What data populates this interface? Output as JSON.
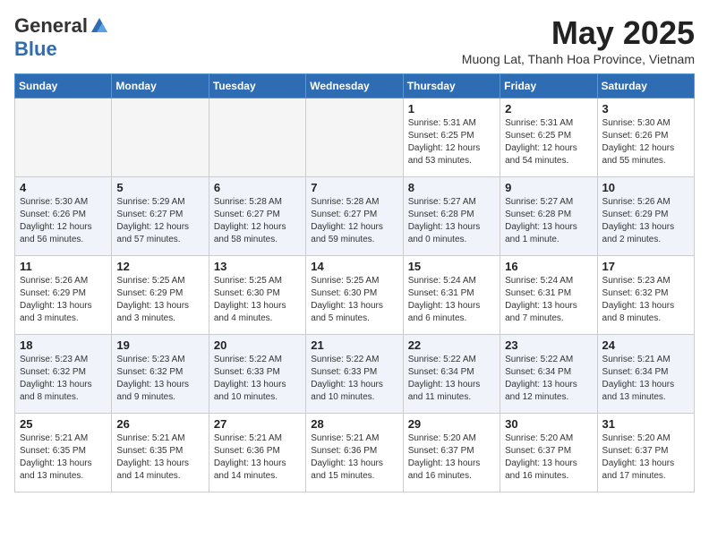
{
  "header": {
    "logo_general": "General",
    "logo_blue": "Blue",
    "month_title": "May 2025",
    "location": "Muong Lat, Thanh Hoa Province, Vietnam"
  },
  "weekdays": [
    "Sunday",
    "Monday",
    "Tuesday",
    "Wednesday",
    "Thursday",
    "Friday",
    "Saturday"
  ],
  "weeks": [
    [
      {
        "day": "",
        "info": ""
      },
      {
        "day": "",
        "info": ""
      },
      {
        "day": "",
        "info": ""
      },
      {
        "day": "",
        "info": ""
      },
      {
        "day": "1",
        "info": "Sunrise: 5:31 AM\nSunset: 6:25 PM\nDaylight: 12 hours\nand 53 minutes."
      },
      {
        "day": "2",
        "info": "Sunrise: 5:31 AM\nSunset: 6:25 PM\nDaylight: 12 hours\nand 54 minutes."
      },
      {
        "day": "3",
        "info": "Sunrise: 5:30 AM\nSunset: 6:26 PM\nDaylight: 12 hours\nand 55 minutes."
      }
    ],
    [
      {
        "day": "4",
        "info": "Sunrise: 5:30 AM\nSunset: 6:26 PM\nDaylight: 12 hours\nand 56 minutes."
      },
      {
        "day": "5",
        "info": "Sunrise: 5:29 AM\nSunset: 6:27 PM\nDaylight: 12 hours\nand 57 minutes."
      },
      {
        "day": "6",
        "info": "Sunrise: 5:28 AM\nSunset: 6:27 PM\nDaylight: 12 hours\nand 58 minutes."
      },
      {
        "day": "7",
        "info": "Sunrise: 5:28 AM\nSunset: 6:27 PM\nDaylight: 12 hours\nand 59 minutes."
      },
      {
        "day": "8",
        "info": "Sunrise: 5:27 AM\nSunset: 6:28 PM\nDaylight: 13 hours\nand 0 minutes."
      },
      {
        "day": "9",
        "info": "Sunrise: 5:27 AM\nSunset: 6:28 PM\nDaylight: 13 hours\nand 1 minute."
      },
      {
        "day": "10",
        "info": "Sunrise: 5:26 AM\nSunset: 6:29 PM\nDaylight: 13 hours\nand 2 minutes."
      }
    ],
    [
      {
        "day": "11",
        "info": "Sunrise: 5:26 AM\nSunset: 6:29 PM\nDaylight: 13 hours\nand 3 minutes."
      },
      {
        "day": "12",
        "info": "Sunrise: 5:25 AM\nSunset: 6:29 PM\nDaylight: 13 hours\nand 3 minutes."
      },
      {
        "day": "13",
        "info": "Sunrise: 5:25 AM\nSunset: 6:30 PM\nDaylight: 13 hours\nand 4 minutes."
      },
      {
        "day": "14",
        "info": "Sunrise: 5:25 AM\nSunset: 6:30 PM\nDaylight: 13 hours\nand 5 minutes."
      },
      {
        "day": "15",
        "info": "Sunrise: 5:24 AM\nSunset: 6:31 PM\nDaylight: 13 hours\nand 6 minutes."
      },
      {
        "day": "16",
        "info": "Sunrise: 5:24 AM\nSunset: 6:31 PM\nDaylight: 13 hours\nand 7 minutes."
      },
      {
        "day": "17",
        "info": "Sunrise: 5:23 AM\nSunset: 6:32 PM\nDaylight: 13 hours\nand 8 minutes."
      }
    ],
    [
      {
        "day": "18",
        "info": "Sunrise: 5:23 AM\nSunset: 6:32 PM\nDaylight: 13 hours\nand 8 minutes."
      },
      {
        "day": "19",
        "info": "Sunrise: 5:23 AM\nSunset: 6:32 PM\nDaylight: 13 hours\nand 9 minutes."
      },
      {
        "day": "20",
        "info": "Sunrise: 5:22 AM\nSunset: 6:33 PM\nDaylight: 13 hours\nand 10 minutes."
      },
      {
        "day": "21",
        "info": "Sunrise: 5:22 AM\nSunset: 6:33 PM\nDaylight: 13 hours\nand 10 minutes."
      },
      {
        "day": "22",
        "info": "Sunrise: 5:22 AM\nSunset: 6:34 PM\nDaylight: 13 hours\nand 11 minutes."
      },
      {
        "day": "23",
        "info": "Sunrise: 5:22 AM\nSunset: 6:34 PM\nDaylight: 13 hours\nand 12 minutes."
      },
      {
        "day": "24",
        "info": "Sunrise: 5:21 AM\nSunset: 6:34 PM\nDaylight: 13 hours\nand 13 minutes."
      }
    ],
    [
      {
        "day": "25",
        "info": "Sunrise: 5:21 AM\nSunset: 6:35 PM\nDaylight: 13 hours\nand 13 minutes."
      },
      {
        "day": "26",
        "info": "Sunrise: 5:21 AM\nSunset: 6:35 PM\nDaylight: 13 hours\nand 14 minutes."
      },
      {
        "day": "27",
        "info": "Sunrise: 5:21 AM\nSunset: 6:36 PM\nDaylight: 13 hours\nand 14 minutes."
      },
      {
        "day": "28",
        "info": "Sunrise: 5:21 AM\nSunset: 6:36 PM\nDaylight: 13 hours\nand 15 minutes."
      },
      {
        "day": "29",
        "info": "Sunrise: 5:20 AM\nSunset: 6:37 PM\nDaylight: 13 hours\nand 16 minutes."
      },
      {
        "day": "30",
        "info": "Sunrise: 5:20 AM\nSunset: 6:37 PM\nDaylight: 13 hours\nand 16 minutes."
      },
      {
        "day": "31",
        "info": "Sunrise: 5:20 AM\nSunset: 6:37 PM\nDaylight: 13 hours\nand 17 minutes."
      }
    ]
  ]
}
